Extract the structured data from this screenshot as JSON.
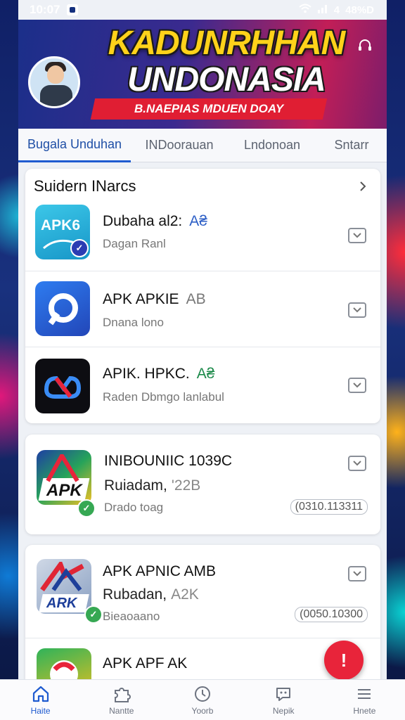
{
  "status_bar": {
    "time": "10:07",
    "indicators": "4",
    "battery": "48%D"
  },
  "banner": {
    "title_line1": "KADUNRHHAN",
    "title_line2": "UNDONASIA",
    "ribbon_text": "B.NAEPIAS MDUEN DOAY"
  },
  "tabs": [
    {
      "label": "Bugala Unduhan"
    },
    {
      "label": "INDoorauan"
    },
    {
      "label": "Lndonoan"
    },
    {
      "label": "Sntarr"
    }
  ],
  "section": {
    "title": "Suidern INarcs"
  },
  "apps": [
    {
      "name": "Dubaha al2:",
      "accent": "A₴",
      "sub": "Dagan Ranl",
      "icon_text": "APK6"
    },
    {
      "name": "APK APKIE",
      "accent": "AB",
      "sub": "Dnana lono"
    },
    {
      "name": "APIK. HPKC.",
      "accent": "A₴",
      "sub": "Raden Dbmgo lanlabul"
    },
    {
      "name": "INIBOUNIIC 1039C",
      "line2": "Ruiadam,",
      "line2_muted": "'22B",
      "sub": "Drado toag",
      "meta": "(0310.113311",
      "icon_text": "APK"
    },
    {
      "name": "APK APNIC AMB",
      "line2": "Rubadan,",
      "line2_muted": "A2K",
      "sub": "Bieaoaano",
      "meta": "(0050.10300",
      "icon_text": "ARK"
    },
    {
      "name": "APK APF AK"
    }
  ],
  "bottom_nav": [
    {
      "label": "Haite"
    },
    {
      "label": "Nantte"
    },
    {
      "label": "Yoorb"
    },
    {
      "label": "Nepik"
    },
    {
      "label": "Hnete"
    }
  ],
  "fab_label": "!",
  "colors": {
    "accent": "#1f5bd0",
    "fab": "#e8243a",
    "banner_yellow": "#ffd21a"
  }
}
